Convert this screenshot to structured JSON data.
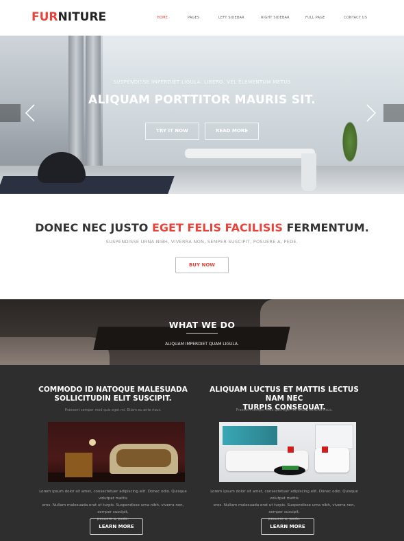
{
  "header": {
    "logo_accent": "FUR",
    "logo_rest": "NITURE",
    "nav": [
      "HOME",
      "PAGES",
      "LEFT SIDEBAR",
      "RIGHT SIDEBAR",
      "FULL PAGE",
      "CONTACT US"
    ],
    "active_nav": "HOME"
  },
  "hero": {
    "subtitle": "SUSPENDISSE IMPERDIET LIGULA. LIBERO, VEL ELEMENTUM METUS",
    "title": "ALIQUAM PORTTITOR MAURIS SIT.",
    "try_label": "TRY IT NOW",
    "read_label": "READ MORE",
    "prev_icon": "chevron-left-icon",
    "next_icon": "chevron-right-icon"
  },
  "promo": {
    "heading_part1": "DONEC NEC JUSTO",
    "heading_red": "EGET FELIS FACILISIS",
    "heading_part2": "FERMENTUM.",
    "subtitle": "SUSPENDISSE URNA NIBH, VIVERRA NON, SEMPER SUSCIPIT, POSUERE A, PEDE.",
    "buy_label": "BUY NOW"
  },
  "what_we_do": {
    "title": "WHAT WE DO",
    "subtitle": "ALIQUAM IMPERDIET QUAM LIGULA."
  },
  "columns": [
    {
      "title_line1": "COMMODO ID NATOQUE MALESUADA",
      "title_line2": "SOLLICITUDIN ELIT SUSCIPIT.",
      "small": "Praesent semper mod quis eget mi. Etiam eu ante risus.",
      "para_line1": "Lorem ipsum dolor sit amet, consectetuer adipiscing elit. Donec odio. Quisque volutpat mattis",
      "para_line2": "eros. Nullam malesuada erat ut turpis. Suspendisse urna nibh, viverra non, semper suscipit,",
      "para_line3": "posuere a, pede.",
      "button": "LEARN MORE"
    },
    {
      "title_line1": "ALIQUAM LUCTUS ET MATTIS LECTUS NAM NEC",
      "title_line2": "TURPIS CONSEQUAT.",
      "small": "Praesent semper mod quis eget mi. Etiam eu ante risus.",
      "para_line1": "Lorem ipsum dolor sit amet, consectetuer adipiscing elit. Donec odio. Quisque volutpat mattis",
      "para_line2": "eros. Nullam malesuada erat ut turpis. Suspendisse urna nibh, viverra non, semper suscipit,",
      "para_line3": "posuere a, pede.",
      "button": "LEARN MORE"
    }
  ],
  "colors": {
    "accent": "#e8433b",
    "dark_bg": "#2e2e2e"
  }
}
